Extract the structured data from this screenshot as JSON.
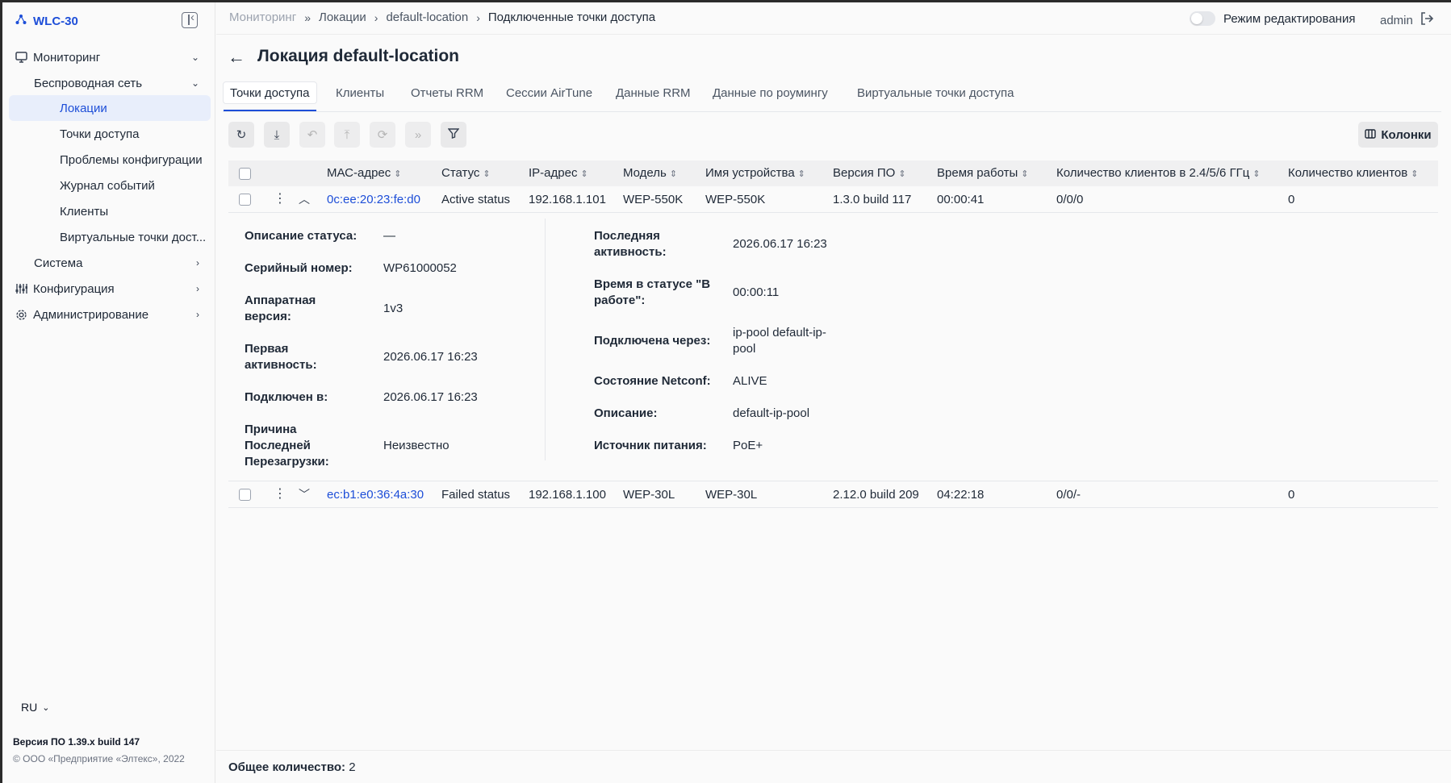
{
  "app": {
    "name": "WLC-30"
  },
  "sidebar": {
    "items": [
      {
        "label": "Мониторинг"
      },
      {
        "label": "Беспроводная сеть"
      },
      {
        "label": "Локации"
      },
      {
        "label": "Точки доступа"
      },
      {
        "label": "Проблемы конфигурации"
      },
      {
        "label": "Журнал событий"
      },
      {
        "label": "Клиенты"
      },
      {
        "label": "Виртуальные точки дост..."
      },
      {
        "label": "Система"
      },
      {
        "label": "Конфигурация"
      },
      {
        "label": "Администрирование"
      }
    ],
    "language": "RU",
    "version": "Версия ПО 1.39.x build 147",
    "copyright": "© ООО «Предприятие «Элтекс», 2022"
  },
  "header": {
    "breadcrumbs": [
      "Мониторинг",
      "Локации",
      "default-location",
      "Подключенные точки доступа"
    ],
    "edit_mode_label": "Режим редактирования",
    "user": "admin"
  },
  "page": {
    "title": "Локация default-location"
  },
  "tabs": [
    {
      "label": "Точки доступа"
    },
    {
      "label": "Клиенты"
    },
    {
      "label": "Отчеты RRM"
    },
    {
      "label": "Сессии AirTune"
    },
    {
      "label": "Данные RRM"
    },
    {
      "label": "Данные по роумингу"
    },
    {
      "label": "Виртуальные точки доступа"
    }
  ],
  "toolbar": {
    "columns_label": "Колонки"
  },
  "table": {
    "headers": [
      "МАС-адрес",
      "Статус",
      "IP-адрес",
      "Модель",
      "Имя устройства",
      "Версия ПО",
      "Время работы",
      "Количество клиентов в 2.4/5/6 ГГц",
      "Количество клиентов"
    ],
    "rows": [
      {
        "mac": "0c:ee:20:23:fe:d0",
        "status": "Active status",
        "ip": "192.168.1.101",
        "model": "WEP-550K",
        "device": "WEP-550K",
        "fw": "1.3.0 build 117",
        "uptime": "00:00:41",
        "clients_band": "0/0/0",
        "clients": "0"
      },
      {
        "mac": "ec:b1:e0:36:4a:30",
        "status": "Failed status",
        "ip": "192.168.1.100",
        "model": "WEP-30L",
        "device": "WEP-30L",
        "fw": "2.12.0 build 209",
        "uptime": "04:22:18",
        "clients_band": "0/0/-",
        "clients": "0"
      }
    ]
  },
  "details": {
    "left": [
      {
        "label": "Описание статуса:",
        "value": "—"
      },
      {
        "label": "Серийный номер:",
        "value": "WP61000052"
      },
      {
        "label": "Аппаратная версия:",
        "value": "1v3"
      },
      {
        "label": "Первая активность:",
        "value": "2026.06.17 16:23"
      },
      {
        "label": "Подключен в:",
        "value": "2026.06.17 16:23"
      },
      {
        "label": "Причина Последней Перезагрузки:",
        "value": "Неизвестно"
      }
    ],
    "right": [
      {
        "label": "Последняя активность:",
        "value": "2026.06.17 16:23"
      },
      {
        "label": "Время в статусе \"В работе\":",
        "value": "00:00:11"
      },
      {
        "label": "Подключена через:",
        "value": "ip-pool default-ip-pool"
      },
      {
        "label": "Состояние Netconf:",
        "value": "ALIVE"
      },
      {
        "label": "Описание:",
        "value": "default-ip-pool"
      },
      {
        "label": "Источник питания:",
        "value": "PoE+"
      }
    ]
  },
  "footer": {
    "total_label": "Общее количество:",
    "total_value": "2"
  }
}
